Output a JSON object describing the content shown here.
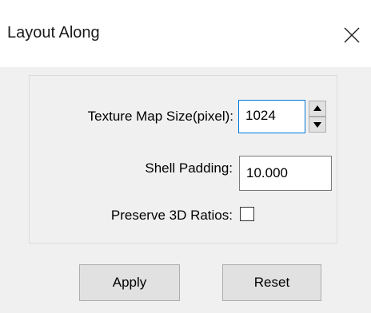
{
  "dialog": {
    "title": "Layout Along",
    "close_glyph": "✕"
  },
  "form": {
    "texture_map_size": {
      "label": "Texture Map Size(pixel):",
      "value": "1024"
    },
    "shell_padding": {
      "label": "Shell Padding:",
      "value": "10.000"
    },
    "preserve_3d_ratios": {
      "label": "Preserve 3D Ratios:",
      "checked": false
    }
  },
  "buttons": {
    "apply": "Apply",
    "reset": "Reset"
  },
  "icons": {
    "spin_up": "triangle-up-icon",
    "spin_down": "triangle-down-icon",
    "close": "close-icon"
  }
}
